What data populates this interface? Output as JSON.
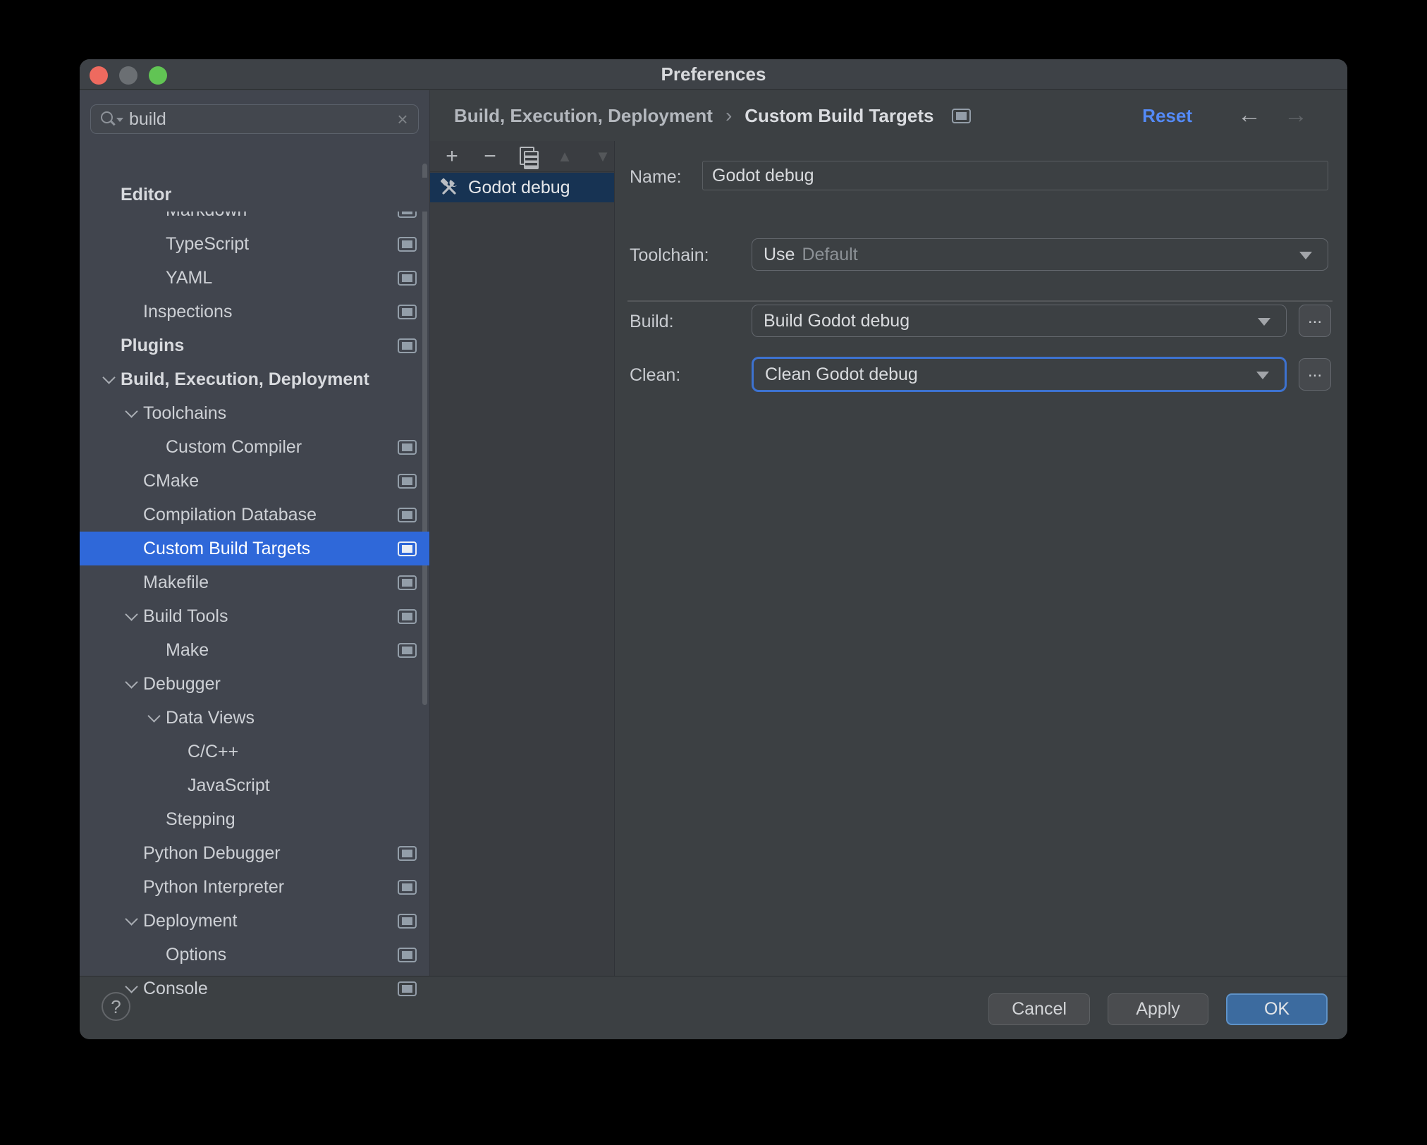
{
  "window": {
    "title": "Preferences"
  },
  "search": {
    "value": "build"
  },
  "icons": {
    "add": "+",
    "remove": "−",
    "move_up": "▲",
    "move_down": "▼",
    "clear": "×",
    "back": "←",
    "forward": "→",
    "help": "?",
    "breadcrumb_separator": "›"
  },
  "breadcrumb": {
    "part1": "Build, Execution, Deployment",
    "part2": "Custom Build Targets",
    "reset_label": "Reset"
  },
  "sidebar": {
    "tree": [
      {
        "label": "Editor",
        "level": 0,
        "bold": true,
        "sticky": true
      },
      {
        "label": "Markdown",
        "level": 2,
        "icon": true,
        "clipped": true
      },
      {
        "label": "TypeScript",
        "level": 2,
        "icon": true
      },
      {
        "label": "YAML",
        "level": 2,
        "icon": true
      },
      {
        "label": "Inspections",
        "level": 1,
        "icon": true
      },
      {
        "label": "Plugins",
        "level": 0,
        "bold": true,
        "icon": true
      },
      {
        "label": "Build, Execution, Deployment",
        "level": 0,
        "bold": true,
        "chevron": true
      },
      {
        "label": "Toolchains",
        "level": 1,
        "chevron": true
      },
      {
        "label": "Custom Compiler",
        "level": 2,
        "icon": true
      },
      {
        "label": "CMake",
        "level": 1,
        "icon": true
      },
      {
        "label": "Compilation Database",
        "level": 1,
        "icon": true
      },
      {
        "label": "Custom Build Targets",
        "level": 1,
        "icon": true,
        "selected": true
      },
      {
        "label": "Makefile",
        "level": 1,
        "icon": true
      },
      {
        "label": "Build Tools",
        "level": 1,
        "chevron": true,
        "icon": true
      },
      {
        "label": "Make",
        "level": 2,
        "icon": true
      },
      {
        "label": "Debugger",
        "level": 1,
        "chevron": true
      },
      {
        "label": "Data Views",
        "level": 2,
        "chevron": true
      },
      {
        "label": "C/C++",
        "level": 3
      },
      {
        "label": "JavaScript",
        "level": 3
      },
      {
        "label": "Stepping",
        "level": 2
      },
      {
        "label": "Python Debugger",
        "level": 1,
        "icon": true
      },
      {
        "label": "Python Interpreter",
        "level": 1,
        "icon": true
      },
      {
        "label": "Deployment",
        "level": 1,
        "chevron": true,
        "icon": true
      },
      {
        "label": "Options",
        "level": 2,
        "icon": true
      },
      {
        "label": "Console",
        "level": 1,
        "chevron": true,
        "icon": true
      }
    ]
  },
  "targets": {
    "items": [
      {
        "label": "Godot debug",
        "selected": true
      }
    ]
  },
  "form": {
    "name_label": "Name:",
    "name_value": "Godot debug",
    "toolchain_label": "Toolchain:",
    "toolchain_prefix": "Use",
    "toolchain_value": "Default",
    "build_label": "Build:",
    "build_value": "Build Godot debug",
    "clean_label": "Clean:",
    "clean_value": "Clean Godot debug",
    "more_label": "..."
  },
  "footer": {
    "cancel_label": "Cancel",
    "apply_label": "Apply",
    "ok_label": "OK"
  },
  "colors": {
    "selection_blue": "#2F68D9",
    "inactive_selection": "#173353",
    "link_blue": "#548AF7",
    "ok_button_blue": "#3C6B9F",
    "focus_ring_blue": "#3D72D0",
    "traffic_red": "#EE6A5F",
    "traffic_green": "#61C454"
  }
}
